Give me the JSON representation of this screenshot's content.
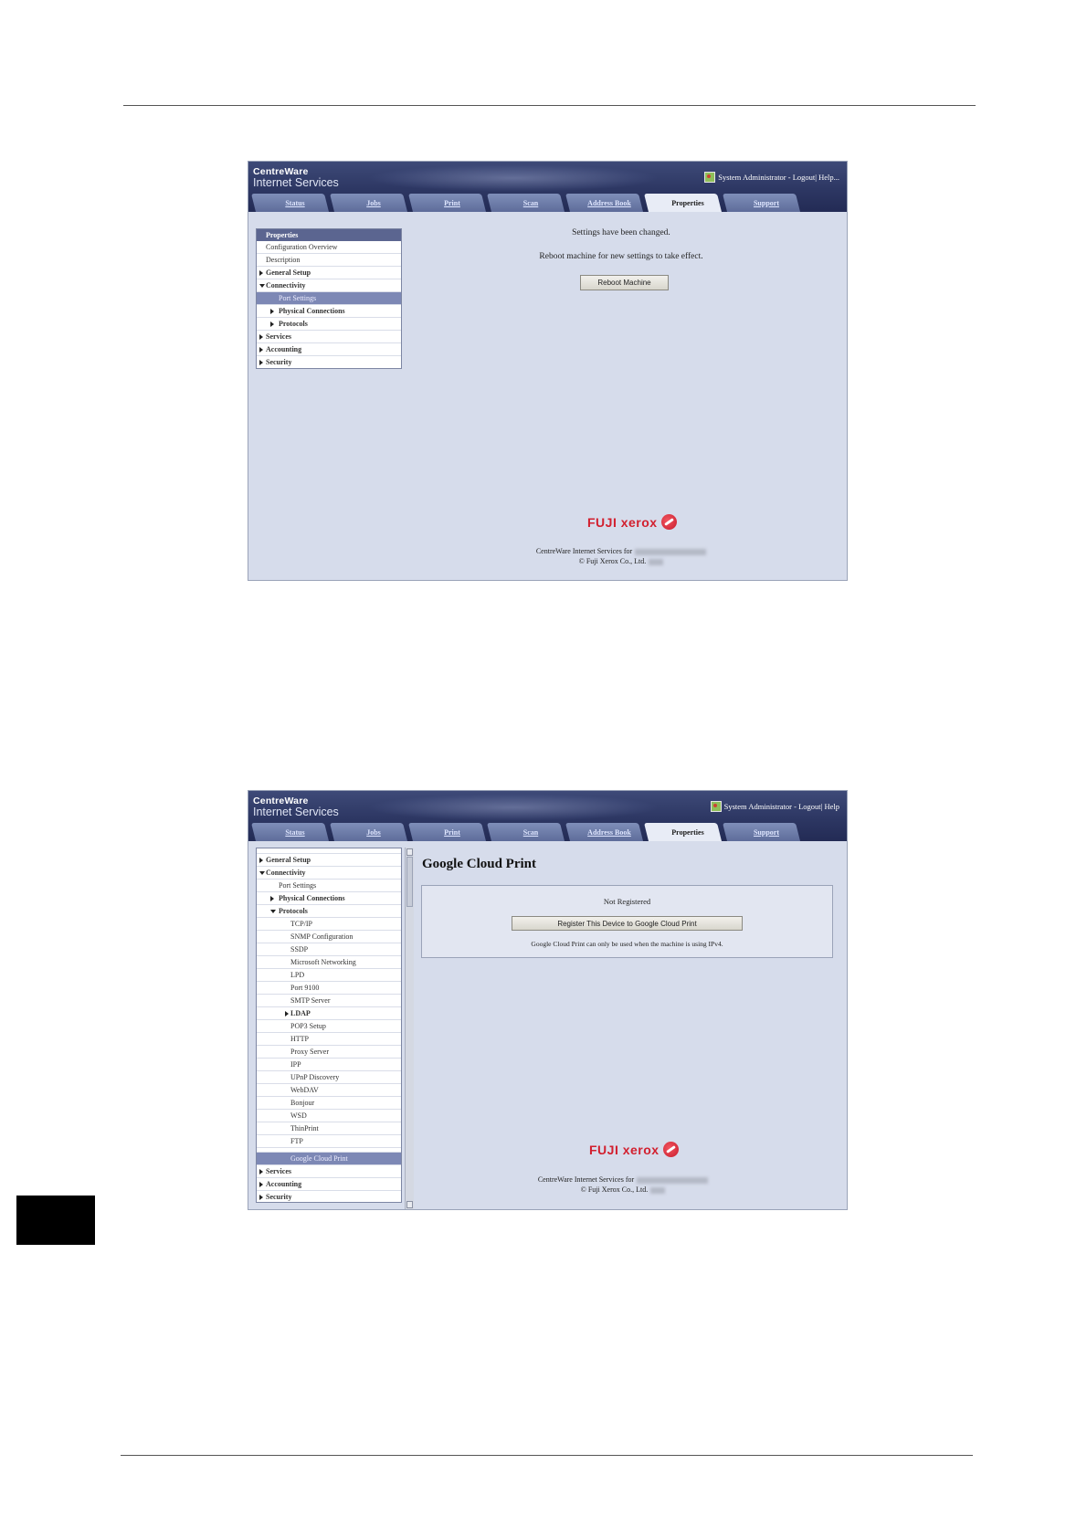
{
  "app": {
    "brand_line1": "CentreWare",
    "brand_line2": "Internet Services",
    "user_links": "System Administrator - Logout| Help...",
    "user_links_2": "System Administrator - Logout| Help",
    "tabs": [
      "Status",
      "Jobs",
      "Print",
      "Scan",
      "Address Book",
      "Properties",
      "Support"
    ],
    "active_tab": "Properties"
  },
  "screen1": {
    "sidebar_title": "Properties",
    "sidebar_items": [
      {
        "label": "Configuration Overview"
      },
      {
        "label": "Description"
      },
      {
        "label": "General Setup"
      },
      {
        "label": "Connectivity"
      },
      {
        "label": "Port Settings"
      },
      {
        "label": "Physical Connections"
      },
      {
        "label": "Protocols"
      },
      {
        "label": "Services"
      },
      {
        "label": "Accounting"
      },
      {
        "label": "Security"
      }
    ],
    "message1": "Settings have been changed.",
    "message2": "Reboot machine for new settings to take effect.",
    "reboot_button": "Reboot Machine"
  },
  "screen2": {
    "sidebar_items": [
      {
        "label": "General Setup"
      },
      {
        "label": "Connectivity"
      },
      {
        "label": "Port Settings"
      },
      {
        "label": "Physical Connections"
      },
      {
        "label": "Protocols"
      },
      {
        "label": "TCP/IP"
      },
      {
        "label": "SNMP Configuration"
      },
      {
        "label": "SSDP"
      },
      {
        "label": "Microsoft Networking"
      },
      {
        "label": "LPD"
      },
      {
        "label": "Port 9100"
      },
      {
        "label": "SMTP Server"
      },
      {
        "label": "LDAP"
      },
      {
        "label": "POP3 Setup"
      },
      {
        "label": "HTTP"
      },
      {
        "label": "Proxy Server"
      },
      {
        "label": "IPP"
      },
      {
        "label": "UPnP Discovery"
      },
      {
        "label": "WebDAV"
      },
      {
        "label": "Bonjour"
      },
      {
        "label": "WSD"
      },
      {
        "label": "ThinPrint"
      },
      {
        "label": "FTP"
      },
      {
        "label": "Google Cloud Print"
      },
      {
        "label": "Services"
      },
      {
        "label": "Accounting"
      },
      {
        "label": "Security"
      }
    ],
    "page_title": "Google Cloud Print",
    "status": "Not Registered",
    "register_button": "Register This Device to Google Cloud Print",
    "note": "Google Cloud Print can only be used when the machine is using IPv4."
  },
  "footer": {
    "logo": "FUJI xerox",
    "line1": "CentreWare Internet Services for",
    "line2": "© Fuji Xerox Co., Ltd."
  },
  "colors": {
    "header": "#2d3763",
    "content_bg": "#d6dceb",
    "sidebar_title": "#5b6590",
    "selected_item": "#7d88b5",
    "brand_red": "#d2202f"
  }
}
